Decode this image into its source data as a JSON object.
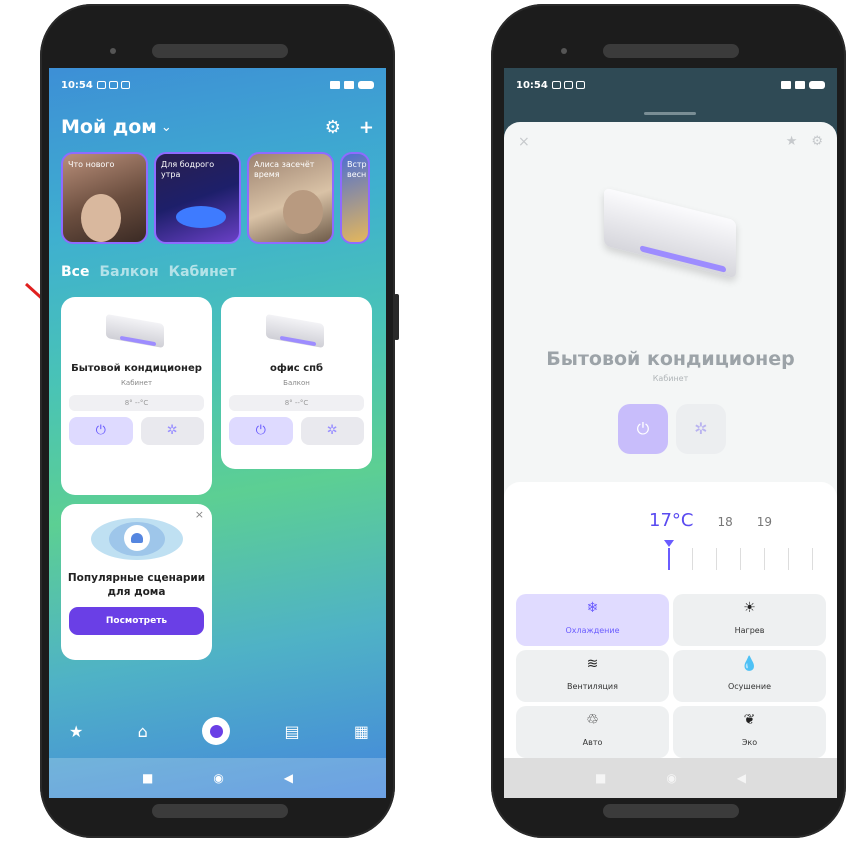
{
  "status_bar": {
    "time": "10:54"
  },
  "left": {
    "header": {
      "title": "Мой дом",
      "chevron": "⌄",
      "gear": "⚙",
      "plus": "+"
    },
    "stories": [
      {
        "label": "Что нового"
      },
      {
        "label": "Для бодрого утра"
      },
      {
        "label": "Алиса засечёт время"
      },
      {
        "label": "Встр весн"
      }
    ],
    "filters": [
      "Все",
      "Балкон",
      "Кабинет"
    ],
    "devices": [
      {
        "name": "Бытовой кондиционер",
        "room": "Кабинет",
        "temp": "8° --°C",
        "power_icon": "⏻",
        "fan_icon": "✲"
      },
      {
        "name": "офис спб",
        "room": "Балкон",
        "temp": "8° --°C",
        "power_icon": "⏻",
        "fan_icon": "✲"
      }
    ],
    "scenarios": {
      "title": "Популярные сценарии для дома",
      "button": "Посмотреть",
      "close": "×"
    },
    "bottom_nav": {
      "star": "★",
      "home": "⌂",
      "tv": "▤",
      "grid": "▦"
    },
    "sys_nav": {
      "square": "■",
      "circle": "◉",
      "back": "◀"
    }
  },
  "right": {
    "device_title": "Бытовой кондиционер",
    "device_room": "Кабинет",
    "close": "×",
    "star": "★",
    "gear": "⚙",
    "power_icon": "⏻",
    "fan_icon": "✲",
    "temp_current": "17°C",
    "temp_next": [
      "18",
      "19"
    ],
    "modes": [
      {
        "label": "Охлаждение",
        "icon": "❄",
        "selected": true
      },
      {
        "label": "Нагрев",
        "icon": "☀",
        "selected": false
      },
      {
        "label": "Вентиляция",
        "icon": "≋",
        "selected": false
      },
      {
        "label": "Осушение",
        "icon": "💧",
        "selected": false
      },
      {
        "label": "Авто",
        "icon": "♲",
        "selected": false
      },
      {
        "label": "Эко",
        "icon": "❦",
        "selected": false
      }
    ],
    "sys_nav": {
      "square": "■",
      "circle": "◉",
      "back": "◀"
    }
  },
  "colors": {
    "accent": "#6a5cff",
    "arrow": "#e0201f",
    "scenario_button": "#6a3fe6"
  }
}
